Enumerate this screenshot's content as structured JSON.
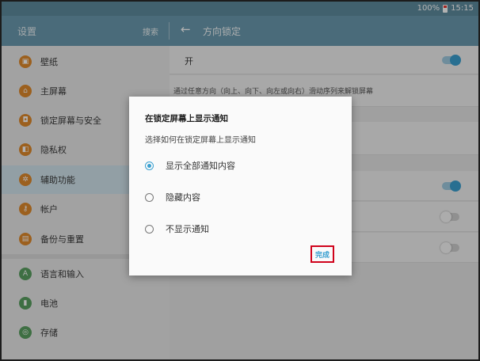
{
  "status_bar": {
    "battery_percent": "100%",
    "time": "15:15"
  },
  "app_bar": {
    "left_title": "设置",
    "search_label": "搜索",
    "back_glyph": "←",
    "right_title": "方向锁定"
  },
  "sidebar": {
    "items": [
      {
        "label": "壁纸",
        "icon": "wallpaper-icon",
        "glyph": "▣",
        "color": "#e08a2c"
      },
      {
        "label": "主屏幕",
        "icon": "home-icon",
        "glyph": "⌂",
        "color": "#e08a2c"
      },
      {
        "label": "锁定屏幕与安全",
        "icon": "lock-icon",
        "glyph": "🔒",
        "color": "#e08a2c"
      },
      {
        "label": "隐私权",
        "icon": "privacy-icon",
        "glyph": "◧",
        "color": "#e08a2c"
      },
      {
        "label": "辅助功能",
        "icon": "accessibility-icon",
        "glyph": "✲",
        "color": "#e08a2c",
        "active": true
      },
      {
        "label": "帐户",
        "icon": "key-icon",
        "glyph": "⚷",
        "color": "#e08a2c"
      },
      {
        "label": "备份与重置",
        "icon": "backup-icon",
        "glyph": "▤",
        "color": "#e08a2c"
      },
      {
        "label": "语言和输入",
        "icon": "language-icon",
        "glyph": "A",
        "color": "#5aa060"
      },
      {
        "label": "电池",
        "icon": "battery-icon",
        "glyph": "▮",
        "color": "#5aa060"
      },
      {
        "label": "存储",
        "icon": "storage-icon",
        "glyph": "◎",
        "color": "#5aa060"
      }
    ]
  },
  "content": {
    "switch_label": "开",
    "switch_on": true,
    "description": "通过任意方向（向上、向下、向左或向右）滑动序列来解锁屏幕",
    "toggle_states": [
      true,
      false,
      false
    ]
  },
  "dialog": {
    "title": "在锁定屏幕上显示通知",
    "subtitle": "选择如何在锁定屏幕上显示通知",
    "options": [
      {
        "label": "显示全部通知内容",
        "selected": true
      },
      {
        "label": "隐藏内容",
        "selected": false
      },
      {
        "label": "不显示通知",
        "selected": false
      }
    ],
    "done_label": "完成"
  },
  "colors": {
    "accent": "#3aa0d0",
    "app_bar": "#6a9aaf",
    "highlight_border": "#d0021b"
  }
}
